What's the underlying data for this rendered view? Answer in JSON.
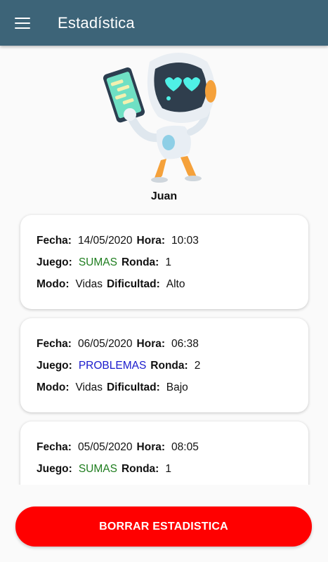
{
  "appbar": {
    "title": "Estadística",
    "menu_icon": "hamburger-icon",
    "color": "#3d6478"
  },
  "profile": {
    "avatar_icon": "robot-with-phone-illustration",
    "name": "Juan"
  },
  "labels": {
    "fecha": "Fecha:",
    "hora": "Hora:",
    "juego": "Juego:",
    "ronda": "Ronda:",
    "modo": "Modo:",
    "dificultad": "Dificultad:"
  },
  "records": [
    {
      "fecha": "14/05/2020",
      "hora": "10:03",
      "juego": "SUMAS",
      "juego_color": "#1e7d1e",
      "ronda": "1",
      "modo": "Vidas",
      "dificultad": "Alto"
    },
    {
      "fecha": "06/05/2020",
      "hora": "06:38",
      "juego": "PROBLEMAS",
      "juego_color": "#1a1acc",
      "ronda": "2",
      "modo": "Vidas",
      "dificultad": "Bajo"
    },
    {
      "fecha": "05/05/2020",
      "hora": "08:05",
      "juego": "SUMAS",
      "juego_color": "#1e7d1e",
      "ronda": "1"
    }
  ],
  "clear_button": {
    "label": "BORRAR ESTADISTICA",
    "color": "#ff0000"
  }
}
